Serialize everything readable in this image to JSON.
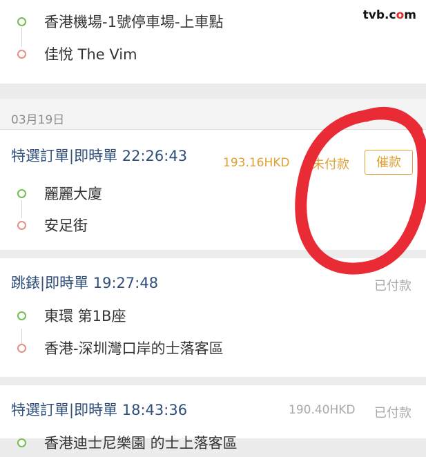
{
  "watermark": {
    "before": "tvb.c",
    "o": "o",
    "after": "m"
  },
  "order0": {
    "pickup": "香港機場-1號停車場-上車點",
    "dropoff": "佳悅 The Vim"
  },
  "date_header": "03月19日",
  "order1": {
    "title": "特選訂單|即時單 22:26:43",
    "price": "193.16HKD",
    "status": "未付款",
    "action": "催款",
    "pickup": "麗麗大廈",
    "dropoff": "安足街"
  },
  "order2": {
    "title": "跳錶|即時單 19:27:48",
    "status": "已付款",
    "pickup": "東環 第1B座",
    "dropoff": "香港-深圳灣口岸的士落客區"
  },
  "order3": {
    "title": "特選訂單|即時單 18:43:36",
    "price": "190.40HKD",
    "status": "已付款",
    "pickup": "香港迪士尼樂園 的士上落客區"
  },
  "colors": {
    "title_blue": "#2f4f7a",
    "accent_orange": "#e0a030",
    "paid_gray": "#a8a8a8",
    "start_dot_green": "#6fc04f",
    "end_dot_red": "#e88d86",
    "annotation_red": "#e8202a"
  }
}
